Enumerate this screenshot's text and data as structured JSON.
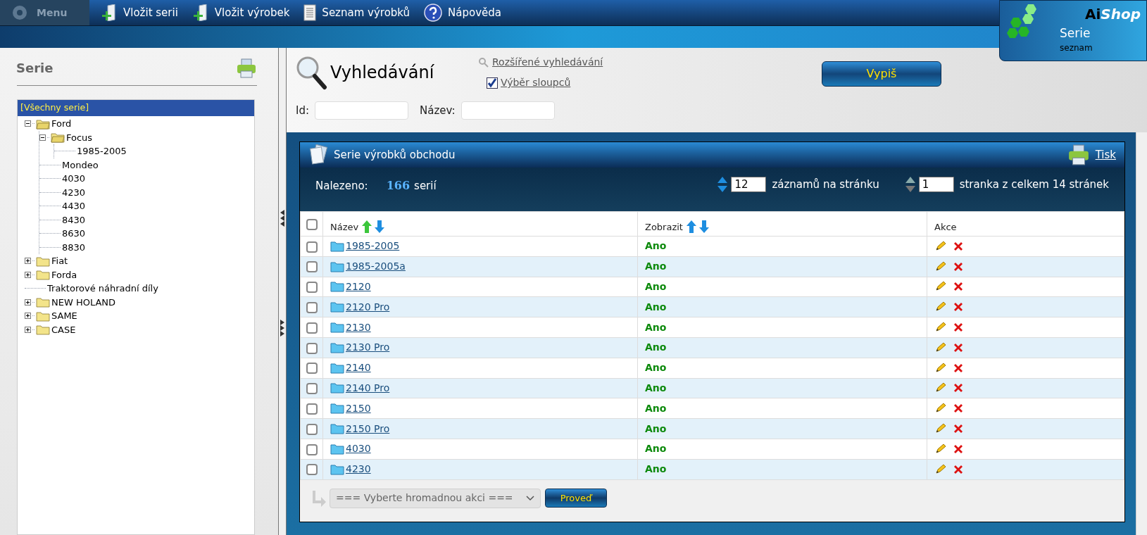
{
  "menu": {
    "label": "Menu",
    "items": [
      {
        "kind": "add",
        "label": "Vložit serii"
      },
      {
        "kind": "add",
        "label": "Vložit výrobek"
      },
      {
        "kind": "list",
        "label": "Seznam výrobků"
      },
      {
        "kind": "help",
        "label": "Nápověda"
      }
    ]
  },
  "brand": {
    "name_bold": "Ai",
    "name_italic": "Shop",
    "section": "Serie",
    "subtitle": "seznam"
  },
  "sidebar": {
    "title": "Serie",
    "root": {
      "label": "[Všechny serie]",
      "selected": true
    },
    "tree": [
      {
        "label": "Ford",
        "kind": "folder",
        "expanded": true,
        "children": [
          {
            "label": "Focus",
            "kind": "folder",
            "expanded": true,
            "children": [
              {
                "label": "1985-2005",
                "kind": "leaf"
              }
            ]
          },
          {
            "label": "Mondeo",
            "kind": "leaf"
          },
          {
            "label": "4030",
            "kind": "leaf"
          },
          {
            "label": "4230",
            "kind": "leaf"
          },
          {
            "label": "4430",
            "kind": "leaf"
          },
          {
            "label": "8430",
            "kind": "leaf"
          },
          {
            "label": "8630",
            "kind": "leaf"
          },
          {
            "label": "8830",
            "kind": "leaf"
          }
        ]
      },
      {
        "label": "Fiat",
        "kind": "folder",
        "expanded": false
      },
      {
        "label": "Forda",
        "kind": "folder",
        "expanded": false
      },
      {
        "label": "Traktorové náhradní díly",
        "kind": "leaf"
      },
      {
        "label": "NEW HOLAND",
        "kind": "folder",
        "expanded": false
      },
      {
        "label": "SAME",
        "kind": "folder",
        "expanded": false
      },
      {
        "label": "CASE",
        "kind": "folder",
        "expanded": false
      }
    ]
  },
  "search": {
    "title": "Vyhledávání",
    "advanced_link": "Rozšířené vyhledávání",
    "columns_link": {
      "label": "Výběr sloupců",
      "checked": true
    },
    "submit": "Vypiš",
    "fields": [
      {
        "label": "Id:"
      },
      {
        "label": "Název:"
      }
    ]
  },
  "panel": {
    "title": "Serie výrobků obchodu",
    "print": "Tisk",
    "found_label": "Nalezeno:",
    "found_count": "166",
    "found_unit": "serií",
    "per_page": "12",
    "per_page_label": "záznamů na stránku",
    "page": "1",
    "page_label": "stranka z celkem 14 stránek",
    "all_checked": false,
    "columns": [
      {
        "label": "Název",
        "sorted": true
      },
      {
        "label": "Zobrazit",
        "sorted": false
      },
      {
        "label": "Akce"
      }
    ],
    "rows": [
      {
        "name": "1985-2005",
        "visible": "Ano",
        "checked": false
      },
      {
        "name": "1985-2005a",
        "visible": "Ano",
        "checked": false
      },
      {
        "name": "2120",
        "visible": "Ano",
        "checked": false
      },
      {
        "name": "2120 Pro",
        "visible": "Ano",
        "checked": false
      },
      {
        "name": "2130",
        "visible": "Ano",
        "checked": false
      },
      {
        "name": "2130 Pro",
        "visible": "Ano",
        "checked": false
      },
      {
        "name": "2140",
        "visible": "Ano",
        "checked": false
      },
      {
        "name": "2140 Pro",
        "visible": "Ano",
        "checked": false
      },
      {
        "name": "2150",
        "visible": "Ano",
        "checked": false
      },
      {
        "name": "2150 Pro",
        "visible": "Ano",
        "checked": false
      },
      {
        "name": "4030",
        "visible": "Ano",
        "checked": false
      },
      {
        "name": "4230",
        "visible": "Ano",
        "checked": false
      }
    ],
    "bulk": {
      "placeholder": "=== Vyberte hromadnou akci ===",
      "button": "Proveď"
    }
  }
}
